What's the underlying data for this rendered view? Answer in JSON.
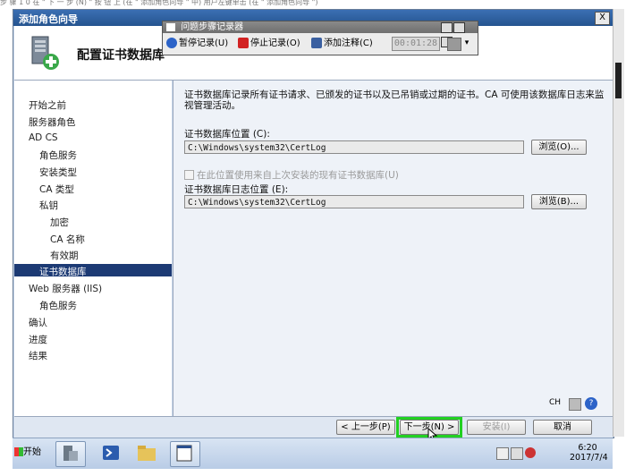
{
  "cut_text": "步 骤 1 0 在 \" 下 一 步 (N) \" 按 钮 上 (在 \" 添加角色向导 \" 中) 用户左键单击 (在 \" 添加角色向导 \")",
  "window": {
    "title": "添加角色向导",
    "close_label": "X"
  },
  "header": {
    "title": "配置证书数据库"
  },
  "nav": {
    "items": [
      {
        "label": "开始之前"
      },
      {
        "label": "服务器角色"
      },
      {
        "label": "AD CS"
      },
      {
        "label": "角色服务"
      },
      {
        "label": "安装类型"
      },
      {
        "label": "CA 类型"
      },
      {
        "label": "私钥"
      },
      {
        "label": "加密"
      },
      {
        "label": "CA 名称"
      },
      {
        "label": "有效期"
      },
      {
        "label": "证书数据库",
        "selected": true
      },
      {
        "label": "Web 服务器 (IIS)"
      },
      {
        "label": "角色服务"
      },
      {
        "label": "确认"
      },
      {
        "label": "进度"
      },
      {
        "label": "结果"
      }
    ]
  },
  "content": {
    "description": "证书数据库记录所有证书请求、已颁发的证书以及已吊销或过期的证书。CA 可使用该数据库日志来监视管理活动。",
    "db_location_label": "证书数据库位置 (C):",
    "db_location_value": "C:\\Windows\\system32\\CertLog",
    "browse1_label": "浏览(O)...",
    "reuse_checkbox_label": "在此位置使用来自上次安装的现有证书数据库(U)",
    "log_location_label": "证书数据库日志位置 (E):",
    "log_location_value": "C:\\Windows\\system32\\CertLog",
    "browse2_label": "浏览(B)..."
  },
  "footer": {
    "prev_label": "< 上一步(P)",
    "next_label": "下一步(N) >",
    "install_label": "安装(I)",
    "cancel_label": "取消"
  },
  "recorder": {
    "title": "问题步骤记录器",
    "pause_label": "暂停记录(U)",
    "stop_label": "停止记录(O)",
    "comment_label": "添加注释(C)",
    "timer": "00:01:28"
  },
  "taskbar": {
    "start_label": "开始",
    "lang": "CH",
    "time": "6:20",
    "date": "2017/7/4"
  },
  "colors": {
    "accent": "#1c3a74",
    "highlight": "#22d022"
  }
}
